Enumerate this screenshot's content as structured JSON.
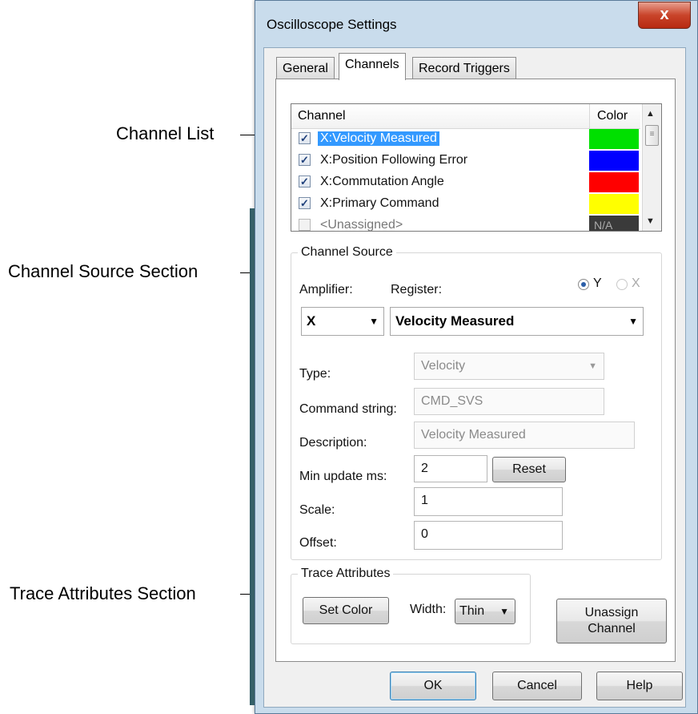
{
  "annotations": {
    "channel_list": "Channel List",
    "channel_source": "Channel Source Section",
    "trace_attributes": "Trace Attributes Section"
  },
  "window": {
    "title": "Oscilloscope Settings",
    "close_glyph": "x"
  },
  "tabs": [
    {
      "label": "General",
      "active": false
    },
    {
      "label": "Channels",
      "active": true
    },
    {
      "label": "Record Triggers",
      "active": false
    }
  ],
  "channel_list": {
    "header_channel": "Channel",
    "header_color": "Color",
    "rows": [
      {
        "checked": true,
        "name": "X:Velocity Measured",
        "color": "#00e000",
        "selected": true
      },
      {
        "checked": true,
        "name": "X:Position Following Error",
        "color": "#0000ff",
        "selected": false
      },
      {
        "checked": true,
        "name": "X:Commutation Angle",
        "color": "#ff0000",
        "selected": false
      },
      {
        "checked": true,
        "name": "X:Primary Command",
        "color": "#ffff00",
        "selected": false
      },
      {
        "checked": false,
        "name": "<Unassigned>",
        "color": "#3a3a3a",
        "color_text": "N/A",
        "selected": false
      }
    ]
  },
  "channel_source": {
    "group_label": "Channel Source",
    "amplifier_label": "Amplifier:",
    "register_label": "Register:",
    "radio_y": "Y",
    "radio_x": "X",
    "radio_selected": "Y",
    "amplifier_value": "X",
    "register_value": "Velocity Measured",
    "type_label": "Type:",
    "type_value": "Velocity",
    "command_label": "Command string:",
    "command_value": "CMD_SVS",
    "description_label": "Description:",
    "description_value": "Velocity Measured",
    "min_update_label": "Min update ms:",
    "min_update_value": "2",
    "reset_label": "Reset",
    "scale_label": "Scale:",
    "scale_value": "1",
    "offset_label": "Offset:",
    "offset_value": "0"
  },
  "trace_attributes": {
    "group_label": "Trace Attributes",
    "set_color_label": "Set Color",
    "width_label": "Width:",
    "width_value": "Thin",
    "unassign_line1": "Unassign",
    "unassign_line2": "Channel"
  },
  "footer": {
    "ok_label": "OK",
    "cancel_label": "Cancel",
    "help_label": "Help"
  },
  "colors": {
    "selection": "#3399ff",
    "title_bar": "#c9dcec",
    "close_button": "#c9442a"
  }
}
